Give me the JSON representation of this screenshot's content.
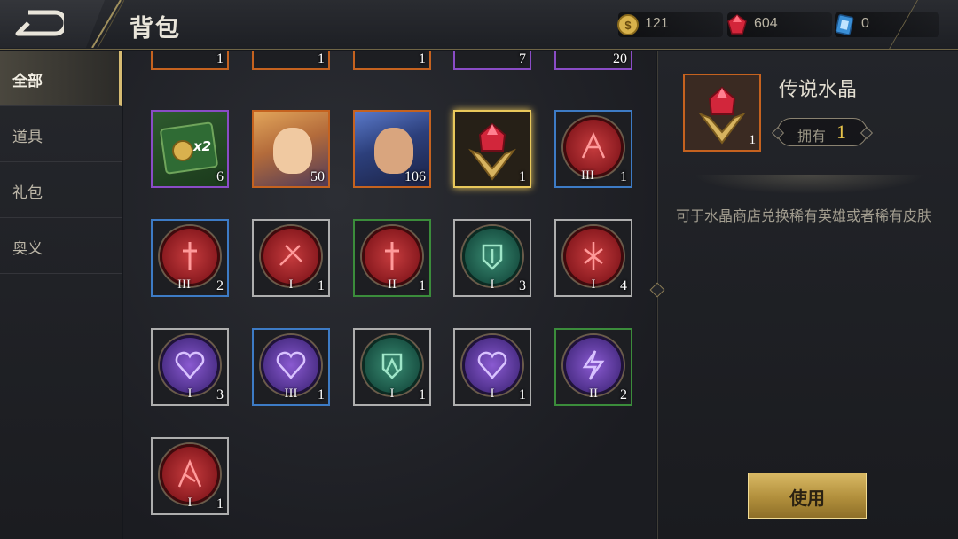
{
  "header": {
    "title": "背包"
  },
  "currencies": {
    "gold": "121",
    "gems": "604",
    "tickets": "0"
  },
  "tabs": [
    {
      "label": "全部",
      "active": true
    },
    {
      "label": "道具",
      "active": false
    },
    {
      "label": "礼包",
      "active": false
    },
    {
      "label": "奥义",
      "active": false
    }
  ],
  "partial_row": {
    "counts": [
      "1",
      "1",
      "1",
      "7",
      "20"
    ]
  },
  "items": [
    {
      "kind": "voucher",
      "rarity": "purple",
      "badge": "x2",
      "count": "6"
    },
    {
      "kind": "skin",
      "rarity": "orange",
      "count": "50"
    },
    {
      "kind": "skin",
      "rarity": "orange",
      "count": "106"
    },
    {
      "kind": "crystal",
      "rarity": "gold-selected",
      "count": "1"
    },
    {
      "kind": "emblem-red",
      "rarity": "blue",
      "roman": "III",
      "count": "1"
    },
    {
      "kind": "emblem-red",
      "rarity": "blue",
      "roman": "III",
      "count": "2"
    },
    {
      "kind": "emblem-red",
      "rarity": "white",
      "roman": "I",
      "count": "1"
    },
    {
      "kind": "emblem-red",
      "rarity": "green",
      "roman": "II",
      "count": "1"
    },
    {
      "kind": "emblem-green",
      "rarity": "white",
      "roman": "I",
      "count": "3"
    },
    {
      "kind": "emblem-red",
      "rarity": "white",
      "roman": "I",
      "count": "4"
    },
    {
      "kind": "emblem-purple",
      "rarity": "white",
      "roman": "I",
      "count": "3"
    },
    {
      "kind": "emblem-purple",
      "rarity": "blue",
      "roman": "III",
      "count": "1"
    },
    {
      "kind": "emblem-green",
      "rarity": "white",
      "roman": "I",
      "count": "1"
    },
    {
      "kind": "emblem-purple",
      "rarity": "white",
      "roman": "I",
      "count": "1"
    },
    {
      "kind": "emblem-purple",
      "rarity": "green",
      "roman": "II",
      "count": "2"
    },
    {
      "kind": "emblem-red",
      "rarity": "white",
      "roman": "I",
      "count": "1"
    }
  ],
  "detail": {
    "name": "传说水晶",
    "count": "1",
    "owned_label": "拥有",
    "owned_value": "1",
    "description": "可于水晶商店兑换稀有英雄或者稀有皮肤",
    "use_button": "使用"
  },
  "colors": {
    "accent_gold": "#e7c34b",
    "rarity_purple": "#8a4cc6",
    "rarity_orange": "#c5621f",
    "rarity_blue": "#3d7bc5",
    "rarity_green": "#3b8c3b",
    "rarity_white": "#aeaeae"
  }
}
